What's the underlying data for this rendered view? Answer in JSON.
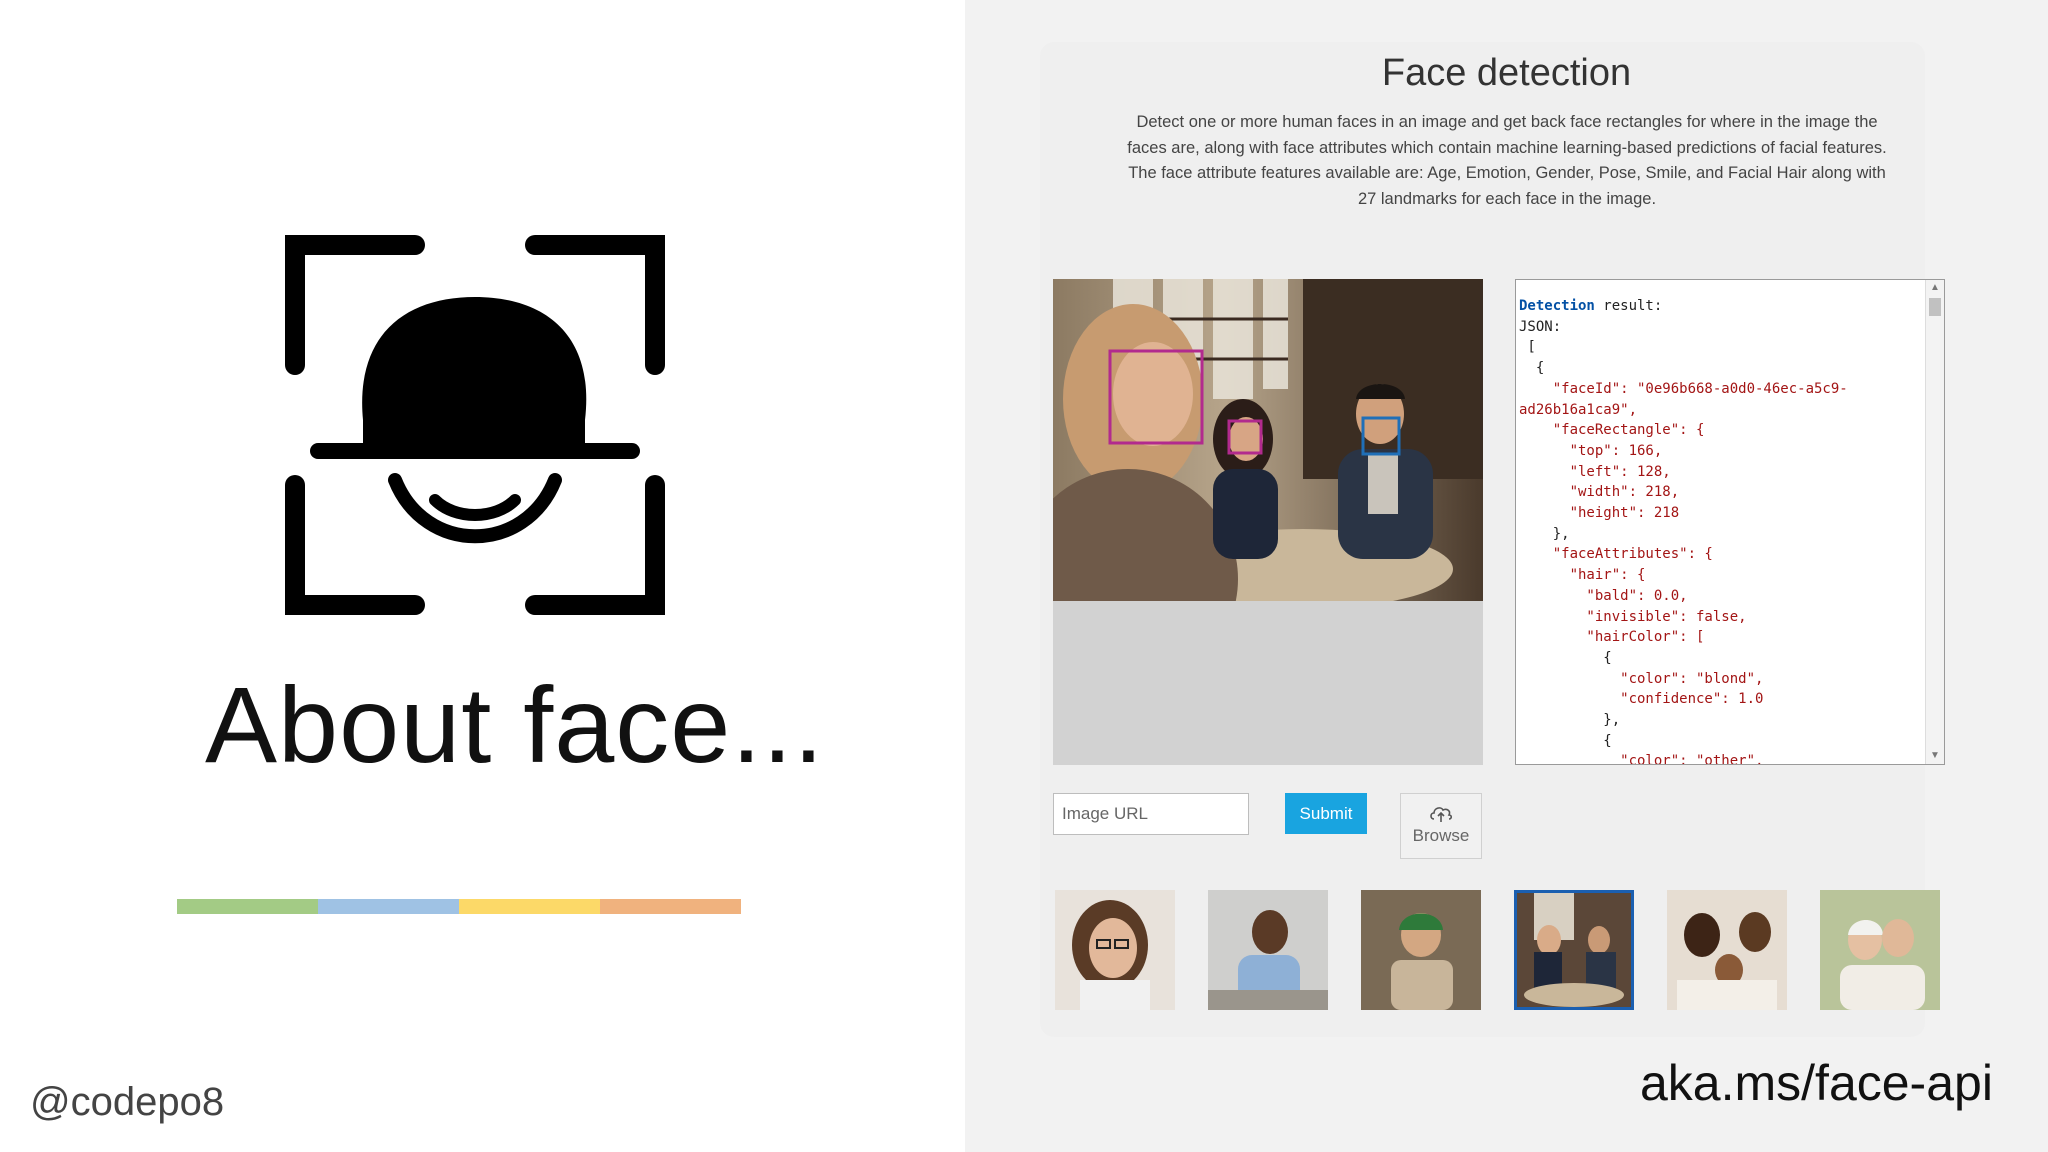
{
  "slide": {
    "title": "About face...",
    "handle": "@codepo8",
    "link": "aka.ms/face-api",
    "accent_colors": [
      "#a3cb85",
      "#9fc2e4",
      "#fcd968",
      "#f0b27e"
    ]
  },
  "demo": {
    "title": "Face detection",
    "description": "Detect one or more human faces in an image and get back face rectangles for where in the image the faces are, along with face attributes which contain machine learning-based predictions of facial features. The face attribute features available are: Age, Emotion, Gender, Pose, Smile, and Facial Hair along with 27 landmarks for each face in the image.",
    "image_url_placeholder": "Image URL",
    "submit_label": "Submit",
    "browse_label": "Browse",
    "result_head_word": "Detection",
    "result_head_rest": " result:",
    "json_label": "JSON:",
    "json_lines": [
      " [",
      "  {",
      "    \"faceId\": \"0e96b668-a0d0-46ec-a5c9-",
      "ad26b16a1ca9\",",
      "    \"faceRectangle\": {",
      "      \"top\": 166,",
      "      \"left\": 128,",
      "      \"width\": 218,",
      "      \"height\": 218",
      "    },",
      "    \"faceAttributes\": {",
      "      \"hair\": {",
      "        \"bald\": 0.0,",
      "        \"invisible\": false,",
      "        \"hairColor\": [",
      "          {",
      "            \"color\": \"blond\",",
      "            \"confidence\": 1.0",
      "          },",
      "          {",
      "            \"color\": \"other\","
    ],
    "face_box_colors": [
      "#b22a8e",
      "#b22a8e",
      "#1f6fb8"
    ],
    "thumbnails": [
      "woman-with-glasses",
      "smiling-man",
      "man-in-green-cap",
      "group-at-cafe",
      "family-with-baby",
      "elderly-couple"
    ],
    "selected_thumbnail": 3
  }
}
